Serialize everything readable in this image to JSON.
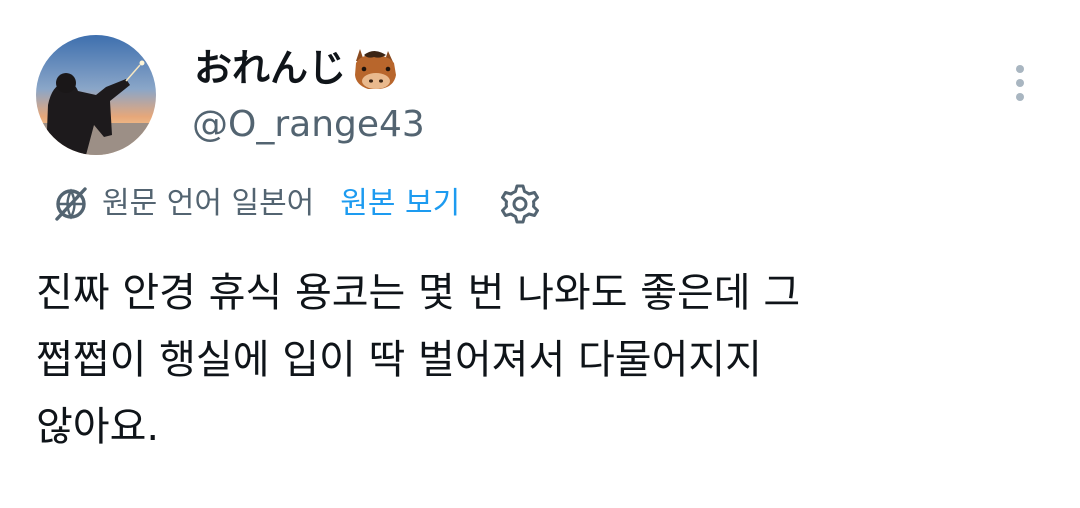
{
  "author": {
    "display_name": "おれんじ",
    "name_emoji_icon": "horse-face-icon",
    "handle": "@O_range43",
    "avatar_icon": "profile-photo"
  },
  "translation_bar": {
    "icon": "translate-icon",
    "text": "원문 언어 일본어",
    "view_original_label": "원본 보기",
    "settings_icon": "gear-icon"
  },
  "tweet": {
    "text": "진짜 안경 휴식 용코는 몇 번 나와도 좋은데 그\n쩝쩝이 행실에 입이 딱 벌어져서 다물어지지\n않아요."
  },
  "colors": {
    "text": "#0f1419",
    "secondary": "#536471",
    "link": "#1d9bf0",
    "more_dots": "#a9b6c1"
  }
}
